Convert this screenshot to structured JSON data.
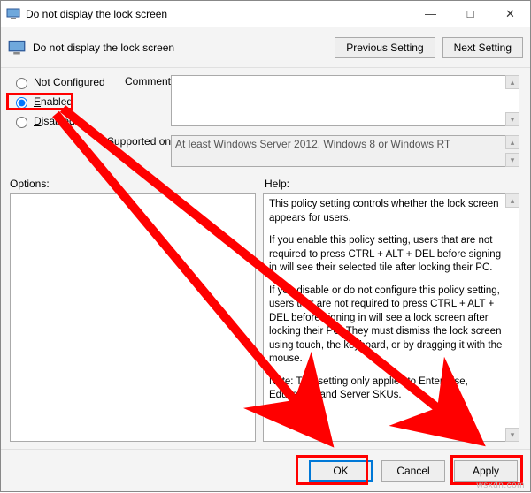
{
  "window": {
    "title": "Do not display the lock screen",
    "min": "—",
    "max": "□",
    "close": "✕"
  },
  "header": {
    "title": "Do not display the lock screen",
    "prev": "Previous Setting",
    "next": "Next Setting"
  },
  "radios": {
    "not_configured": "Not Configured",
    "enabled": "Enabled",
    "disabled": "Disabled",
    "selected": "enabled"
  },
  "labels": {
    "comment": "Comment:",
    "supported": "Supported on:",
    "options": "Options:",
    "help": "Help:"
  },
  "supported_text": "At least Windows Server 2012, Windows 8 or Windows RT",
  "help": {
    "p1": "This policy setting controls whether the lock screen appears for users.",
    "p2": "If you enable this policy setting, users that are not required to press CTRL + ALT + DEL before signing in will see their selected tile after locking their PC.",
    "p3": "If you disable or do not configure this policy setting, users that are not required to press CTRL + ALT + DEL before signing in will see a lock screen after locking their PC. They must dismiss the lock screen using touch, the keyboard, or by dragging it with the mouse.",
    "p4": "Note: This setting only applies to Enterprise, Education, and Server SKUs."
  },
  "buttons": {
    "ok": "OK",
    "cancel": "Cancel",
    "apply": "Apply"
  },
  "watermark": "wsxdn.com"
}
